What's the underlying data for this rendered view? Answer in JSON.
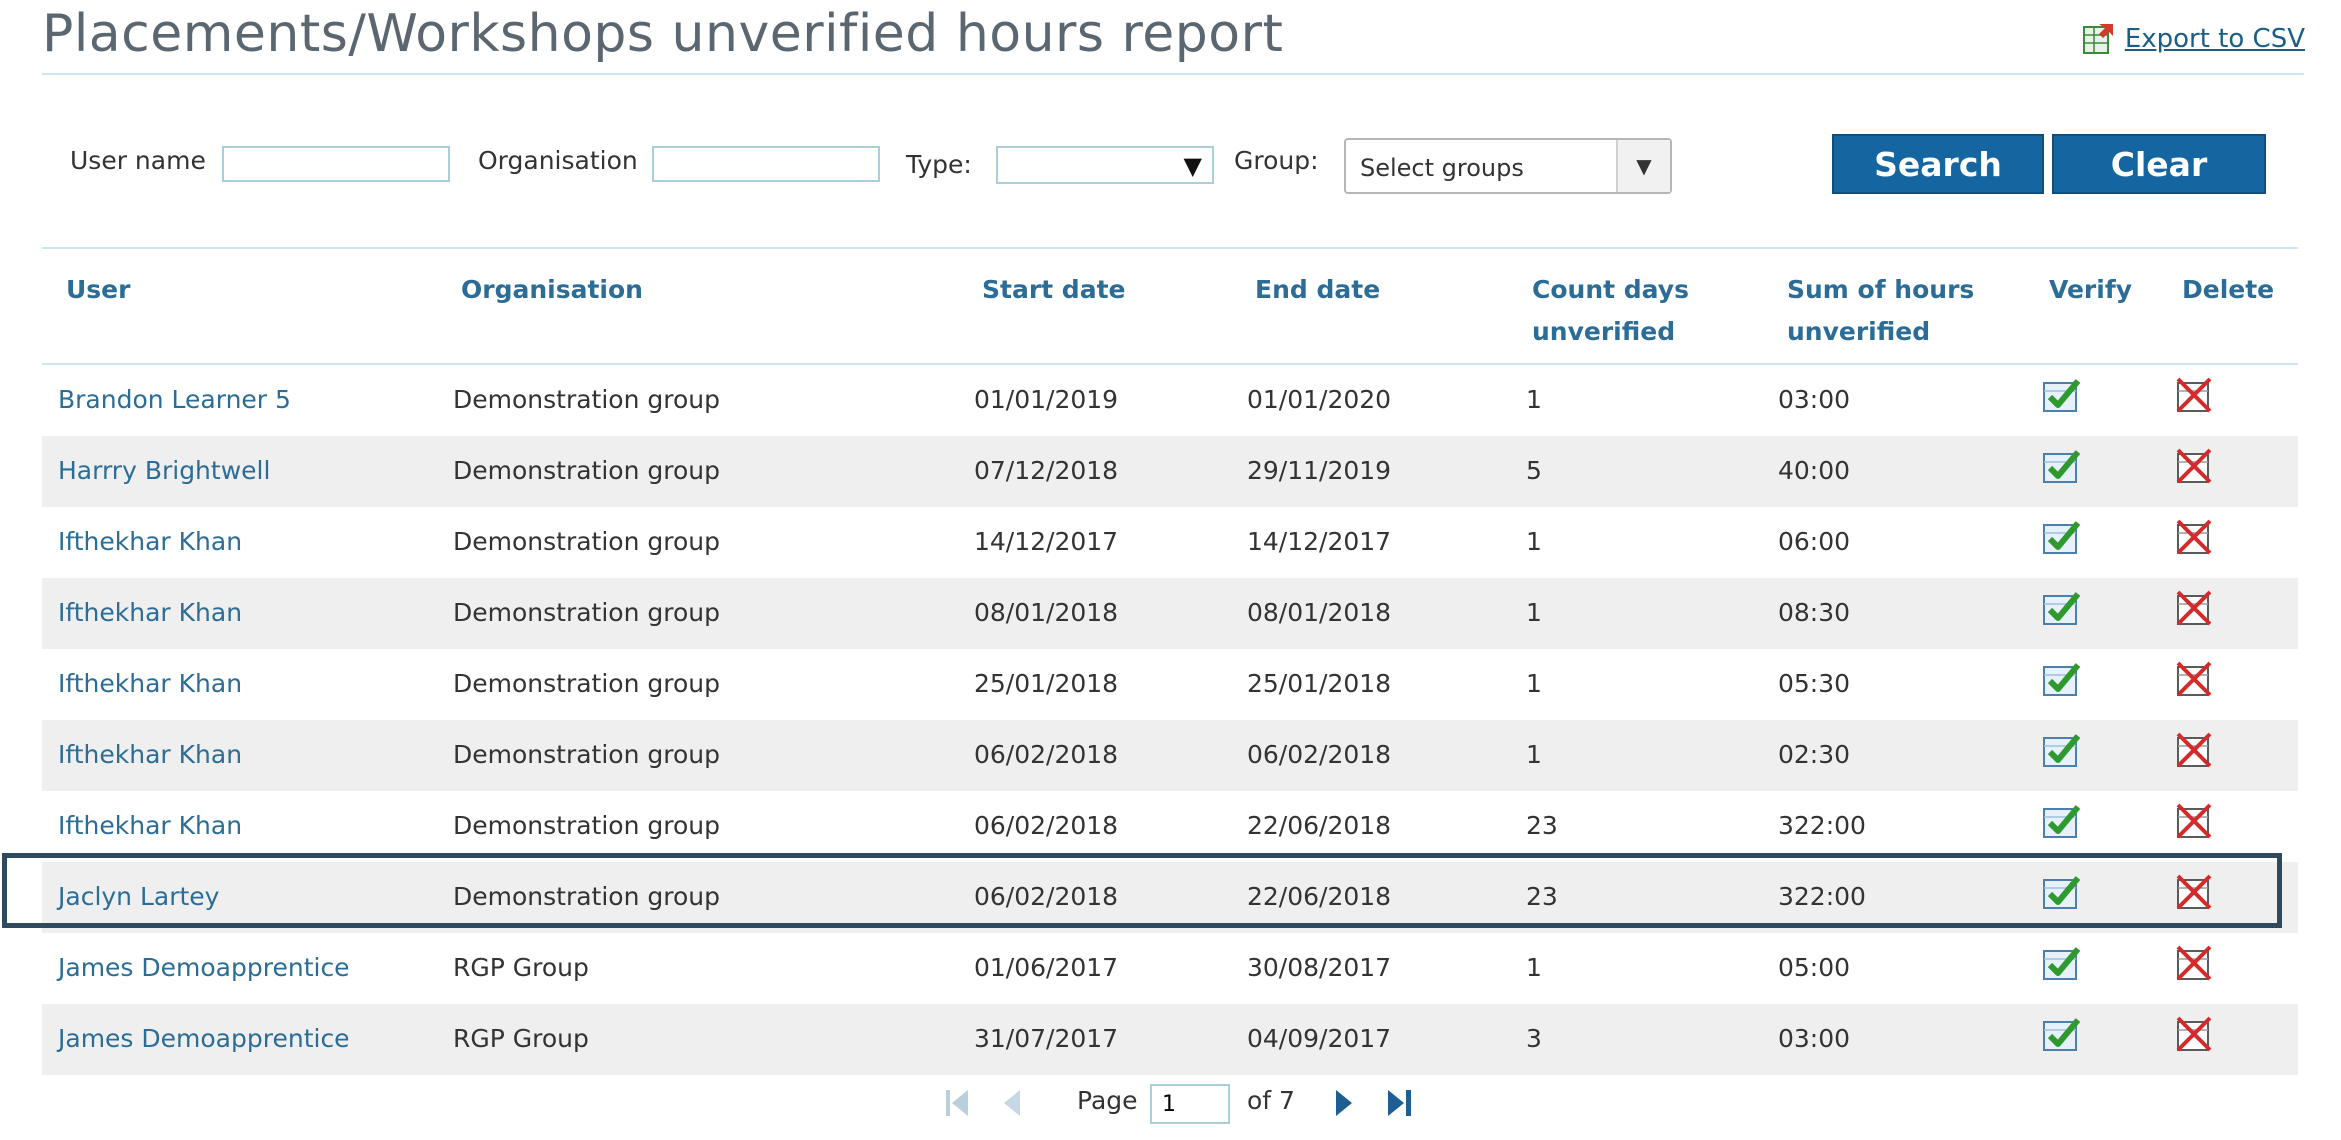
{
  "header": {
    "title": "Placements/Workshops unverified hours report",
    "export_label": "Export to CSV"
  },
  "filters": {
    "user_name_label": "User name",
    "user_name_value": "",
    "organisation_label": "Organisation",
    "organisation_value": "",
    "type_label": "Type:",
    "type_value": "",
    "group_label": "Group:",
    "group_value": "Select groups",
    "search_label": "Search",
    "clear_label": "Clear"
  },
  "table": {
    "columns": {
      "user": "User",
      "organisation": "Organisation",
      "start_date": "Start date",
      "end_date": "End date",
      "count_days_1": "Count days",
      "count_days_2": "unverified",
      "sum_hours_1": "Sum of hours",
      "sum_hours_2": "unverified",
      "verify": "Verify",
      "delete": "Delete"
    },
    "rows": [
      {
        "user": "Brandon Learner 5",
        "organisation": "Demonstration group",
        "start": "01/01/2019",
        "end": "01/01/2020",
        "days": "1",
        "hours": "03:00"
      },
      {
        "user": "Harrry Brightwell",
        "organisation": "Demonstration group",
        "start": "07/12/2018",
        "end": "29/11/2019",
        "days": "5",
        "hours": "40:00"
      },
      {
        "user": "Ifthekhar Khan",
        "organisation": "Demonstration group",
        "start": "14/12/2017",
        "end": "14/12/2017",
        "days": "1",
        "hours": "06:00"
      },
      {
        "user": "Ifthekhar Khan",
        "organisation": "Demonstration group",
        "start": "08/01/2018",
        "end": "08/01/2018",
        "days": "1",
        "hours": "08:30"
      },
      {
        "user": "Ifthekhar Khan",
        "organisation": "Demonstration group",
        "start": "25/01/2018",
        "end": "25/01/2018",
        "days": "1",
        "hours": "05:30"
      },
      {
        "user": "Ifthekhar Khan",
        "organisation": "Demonstration group",
        "start": "06/02/2018",
        "end": "06/02/2018",
        "days": "1",
        "hours": "02:30"
      },
      {
        "user": "Ifthekhar Khan",
        "organisation": "Demonstration group",
        "start": "06/02/2018",
        "end": "22/06/2018",
        "days": "23",
        "hours": "322:00"
      },
      {
        "user": "Jaclyn Lartey",
        "organisation": "Demonstration group",
        "start": "06/02/2018",
        "end": "22/06/2018",
        "days": "23",
        "hours": "322:00"
      },
      {
        "user": "James Demoapprentice",
        "organisation": "RGP Group",
        "start": "01/06/2017",
        "end": "30/08/2017",
        "days": "1",
        "hours": "05:00"
      },
      {
        "user": "James Demoapprentice",
        "organisation": "RGP Group",
        "start": "31/07/2017",
        "end": "04/09/2017",
        "days": "3",
        "hours": "03:00"
      }
    ]
  },
  "pager": {
    "page_label": "Page",
    "current_page": "1",
    "of_label": "of 7"
  },
  "colors": {
    "accent": "#1565a0",
    "link": "#2b6d96",
    "row_alt": "#efefef",
    "highlight_border": "#2f4a5f"
  }
}
